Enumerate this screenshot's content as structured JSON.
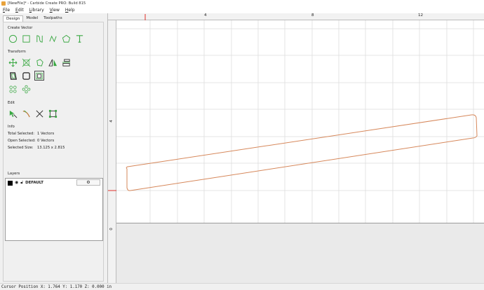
{
  "window": {
    "title": "[NewFile]* - Carbide Create PRO: Build 815"
  },
  "menu": {
    "items": [
      "File",
      "Edit",
      "Library",
      "View",
      "Help"
    ]
  },
  "left_panel": {
    "tabs": [
      {
        "label": "Design",
        "active": true
      },
      {
        "label": "Model",
        "active": false
      },
      {
        "label": "Toolpaths",
        "active": false
      }
    ],
    "sections": {
      "create_vector": "Create Vector",
      "transform": "Transform",
      "edit": "Edit",
      "info": "Info",
      "layers": "Layers"
    },
    "create_vector_icons": [
      "circle-icon",
      "rectangle-icon",
      "curve-icon",
      "polyline-icon",
      "polygon-icon",
      "text-icon"
    ],
    "transform_icons": [
      "move-icon",
      "scale-icon",
      "rotate-icon",
      "mirror-icon",
      "align-icon",
      "offset-icon",
      "boolean-icon",
      "group-icon",
      "circular-array-icon",
      "linear-array-icon"
    ],
    "edit_icons": [
      "node-edit-icon",
      "trim-icon",
      "cut-icon",
      "bounding-box-icon"
    ],
    "info": {
      "total_selected_label": "Total Selected:",
      "total_selected_value": "1 Vectors",
      "open_selected_label": "Open Selected:",
      "open_selected_value": "0 Vectors",
      "selected_size_label": "Selected Size:",
      "selected_size_value": "13.125 x 2.815"
    },
    "layers": [
      {
        "name": "DEFAULT",
        "color": "#000000"
      }
    ]
  },
  "canvas": {
    "top_ruler_labels": [
      "4",
      "8",
      "12"
    ],
    "left_ruler_labels": [
      "4",
      "0"
    ],
    "vector_color": "#d6875a",
    "origin_marker_color": "#e0302a"
  },
  "status": {
    "text": "Cursor Position X: 1.764 Y: 1.170 Z: 0.000 in"
  },
  "colors": {
    "accent_green": "#3aa843"
  }
}
